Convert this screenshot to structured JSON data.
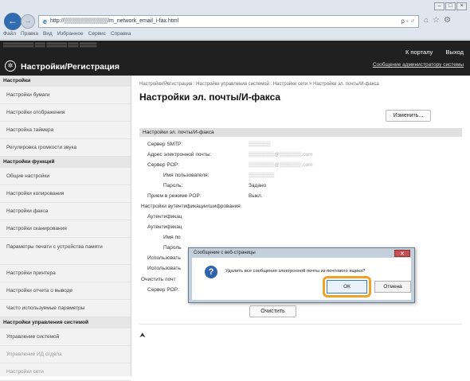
{
  "browser": {
    "url": "http://▒▒▒▒▒▒▒▒▒▒▒/m_network_email_i-fax.html",
    "menu": [
      "Файл",
      "Правка",
      "Вид",
      "Избранное",
      "Сервис",
      "Справка"
    ],
    "window_buttons": [
      "–",
      "□",
      "×"
    ],
    "addr_tools": "ρ - ♂"
  },
  "header": {
    "user_text": "▒▒▒▒▒▒▒▒▒  ▒▒▒ ▒▒▒▒▒▒  ▒▒▒ ▒▒▒▒▒",
    "brand": "Настройки/Регистрация",
    "portal_link": "К порталу",
    "logout_link": "Выход",
    "admin_message": "Сообщение администратору системы"
  },
  "sidebar": {
    "sections": [
      {
        "heading": "Настройки",
        "items": [
          "Настройки бумаги",
          "Настройки отображения",
          "Настройка таймера",
          "Регулировка громкости звука"
        ]
      },
      {
        "heading": "Настройки функций",
        "items": [
          "Общие настройки",
          "Настройки копирования",
          "Настройки факса",
          "Настройки сканирования",
          "Параметры печати с устройства памяти",
          "Настройки принтера",
          "Настройки отчета о выводе",
          "Часто используемые параметры"
        ]
      },
      {
        "heading": "Настройки управления системой",
        "items": [
          "Управление системой",
          "Управление ИД отдела",
          "Настройки сети"
        ]
      }
    ]
  },
  "main": {
    "breadcrumb": "Настройки/Регистрация : Настройки управления системой : Настройки сети > Настройки эл. почты/И-факса",
    "title": "Настройки эл. почты/И-факса",
    "edit_button": "Изменить...",
    "section_title": "Настройки эл. почты/И-факса",
    "rows": [
      {
        "label": "Сервер SMTP:",
        "value": "▒▒▒▒▒▒"
      },
      {
        "label": "Адрес электронной почты:",
        "value": "▒▒▒▒▒▒▒@▒▒▒▒▒▒.com"
      },
      {
        "label": "Сервер POP:",
        "value": "▒▒▒▒▒▒▒@▒▒▒▒▒▒.com"
      },
      {
        "label": "Имя пользователя:",
        "value": "▒▒▒▒▒▒▒"
      },
      {
        "label": "Пароль:",
        "value": "Задано"
      },
      {
        "label": "Прием в режиме POP:",
        "value": "Выкл."
      }
    ],
    "auth_heading": "Настройки аутентификации/шифрования",
    "auth_rows": [
      "Аутентификац",
      "Аутентификац",
      "Имя по",
      "Пароль",
      "Использовать",
      "Использовать",
      "Очистить почт"
    ],
    "pop_label": "Сервер POP:",
    "clear_button": "Очистить",
    "top_link": "⮝"
  },
  "dialog": {
    "title": "Сообщение с веб-страницы",
    "message": "Удалить все сообщения электронной почты из почтового ящика?",
    "ok": "ОК",
    "cancel": "Отмена",
    "close": "✕",
    "icon": "?"
  },
  "colors": {
    "header_bg": "#202020",
    "highlight": "#f0a12a",
    "dialog_frame": "#c3cfdb"
  }
}
